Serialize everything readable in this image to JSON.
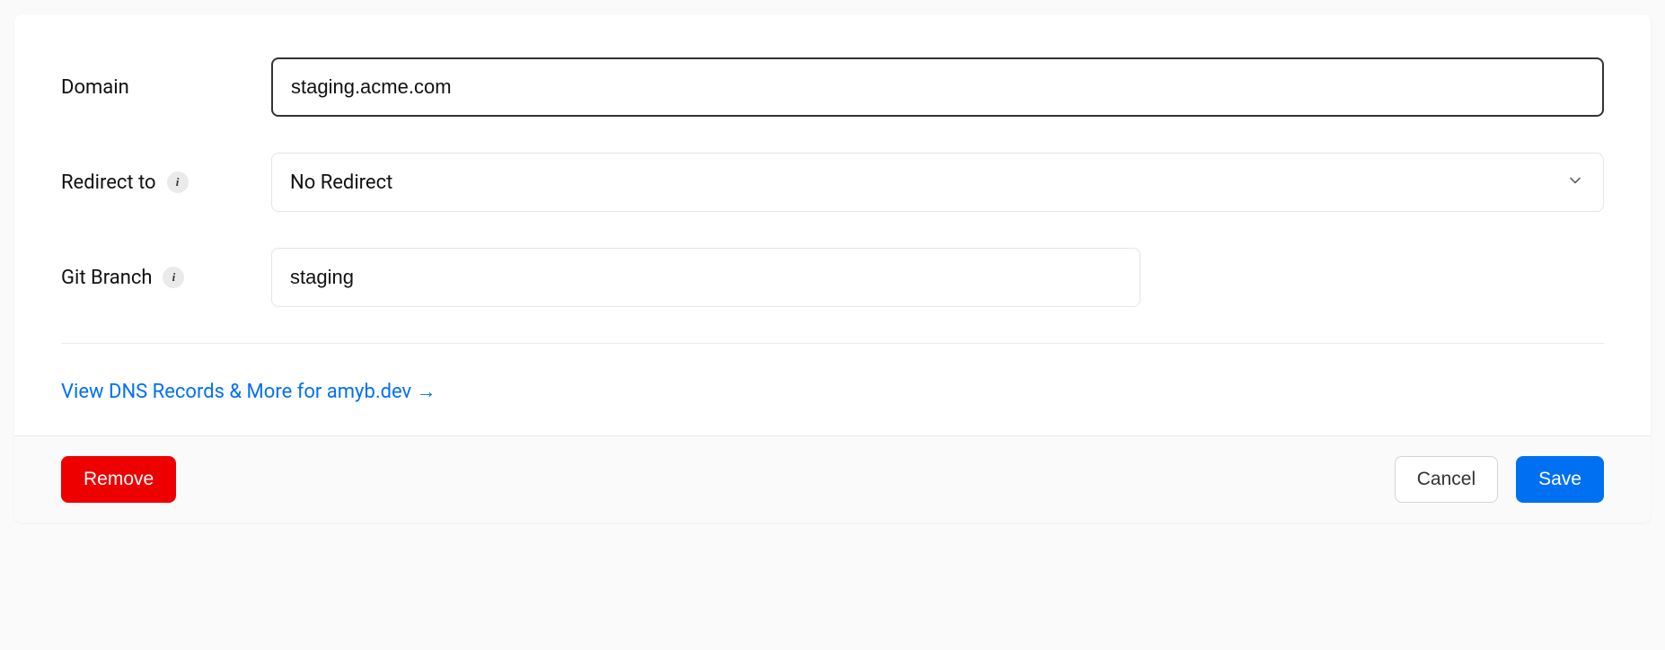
{
  "form": {
    "domain": {
      "label": "Domain",
      "value": "staging.acme.com"
    },
    "redirect": {
      "label": "Redirect to",
      "selected": "No Redirect"
    },
    "gitBranch": {
      "label": "Git Branch",
      "value": "staging"
    }
  },
  "dnsLink": {
    "text": "View DNS Records & More for amyb.dev →"
  },
  "footer": {
    "remove": "Remove",
    "cancel": "Cancel",
    "save": "Save"
  }
}
